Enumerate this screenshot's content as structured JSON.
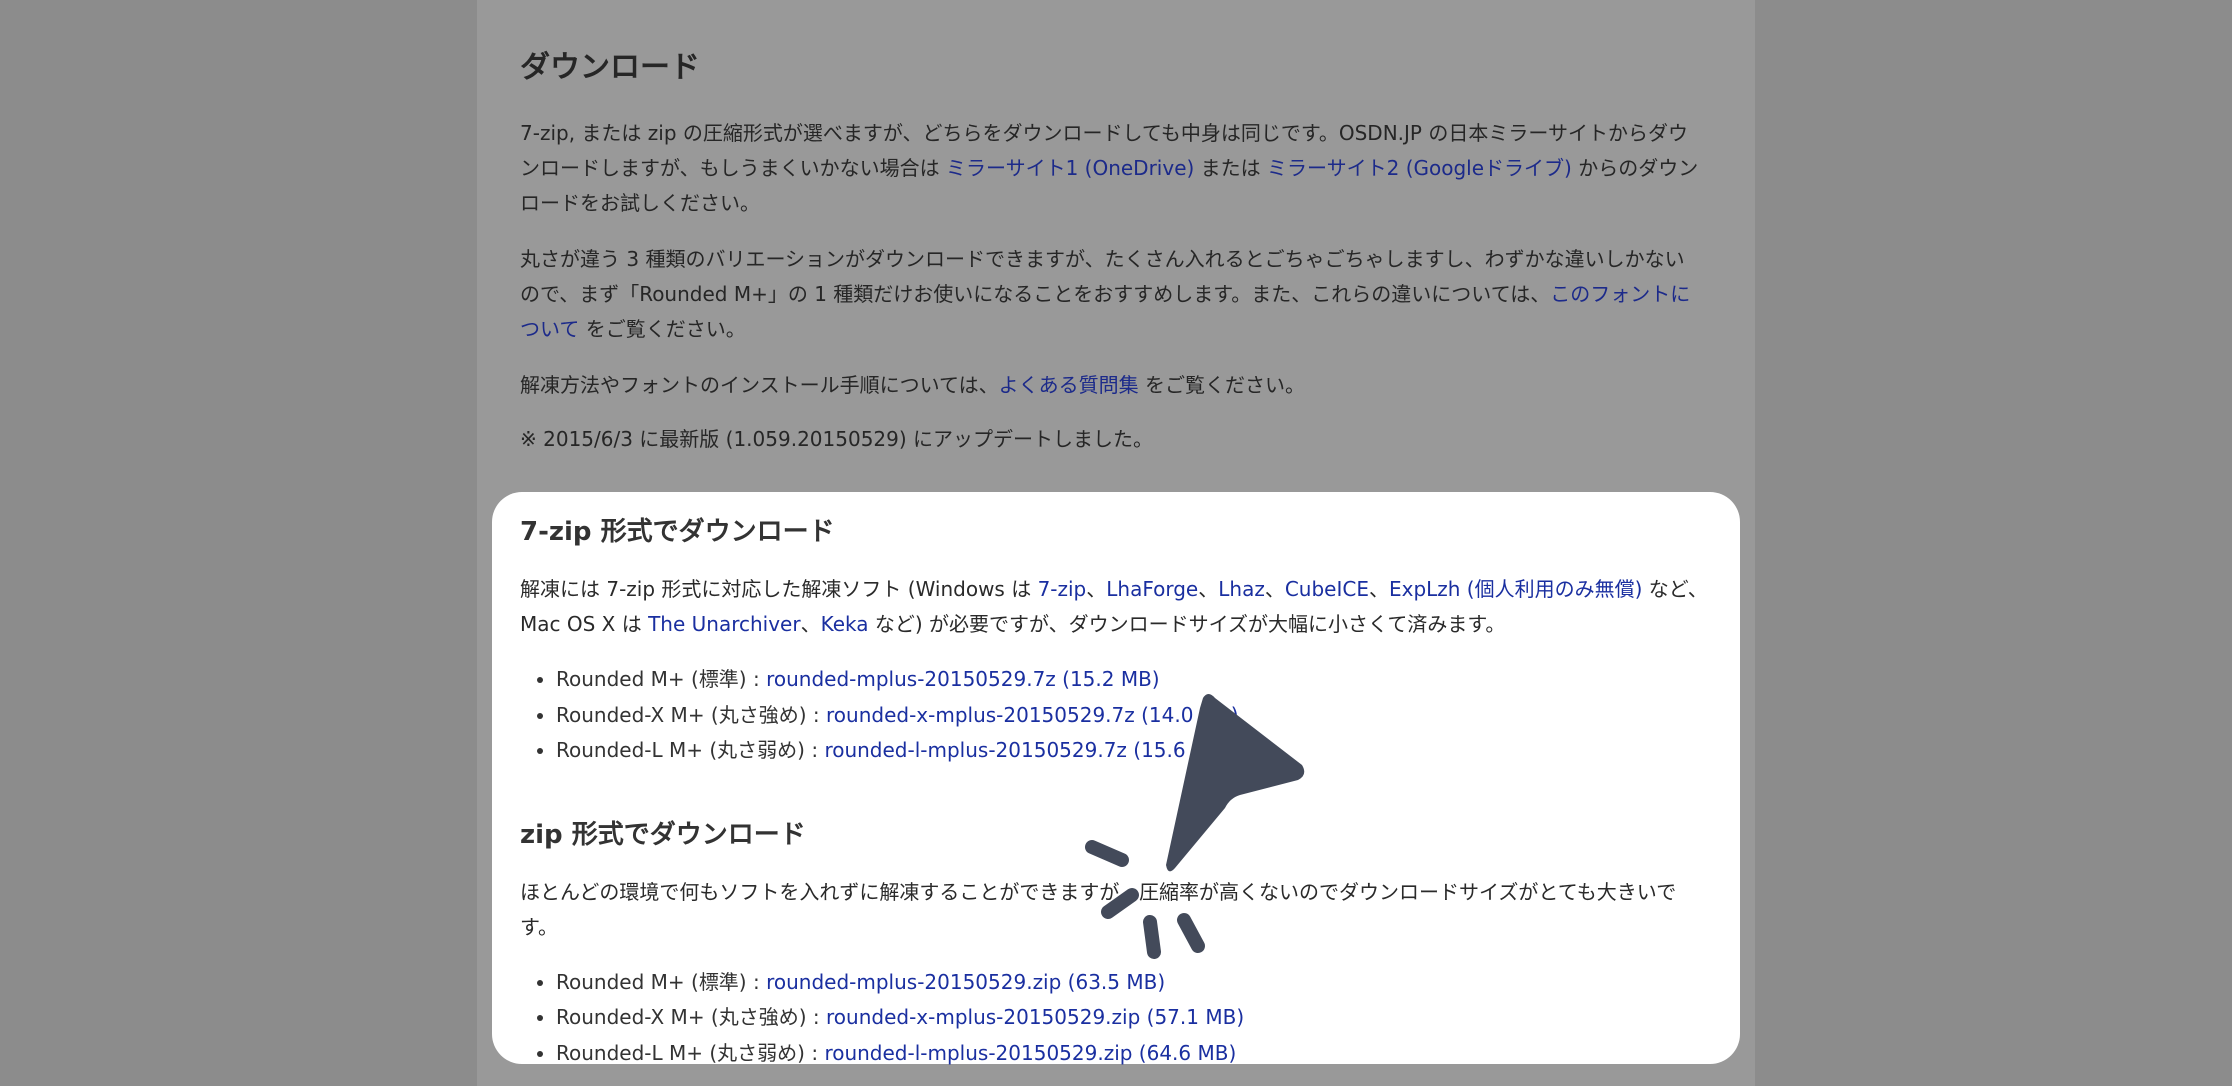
{
  "main": {
    "title": "ダウンロード",
    "p1": {
      "t1": "7-zip, または zip の圧縮形式が選べますが、どちらをダウンロードしても中身は同じです。OSDN.JP の日本ミラーサイトからダウンロードしますが、もしうまくいかない場合は ",
      "link1": "ミラーサイト1 (OneDrive)",
      "t2": " または ",
      "link2": "ミラーサイト2 (Googleドライブ)",
      "t3": " からのダウンロードをお試しください。"
    },
    "p2": {
      "t1": "丸さが違う 3 種類のバリエーションがダウンロードできますが、たくさん入れるとごちゃごちゃしますし、わずかな違いしかないので、まず「Rounded M+」の 1 種類だけお使いになることをおすすめします。また、これらの違いについては、",
      "link": "このフォントについて",
      "t2": " をご覧ください。"
    },
    "p3": {
      "t1": "解凍方法やフォントのインストール手順については、",
      "link": "よくある質問集",
      "t2": " をご覧ください。"
    },
    "p4": "※ 2015/6/3 に最新版 (1.059.20150529) にアップデートしました。"
  },
  "sevenzip": {
    "title": "7-zip 形式でダウンロード",
    "desc": {
      "t1": "解凍には 7-zip 形式に対応した解凍ソフト (Windows は ",
      "l1": "7-zip",
      "s1": "、",
      "l2": "LhaForge",
      "s2": "、",
      "l3": "Lhaz",
      "s3": "、",
      "l4": "CubeICE",
      "s4": "、",
      "l5": "ExpLzh (個人利用のみ無償)",
      "t2": " など、Mac OS X は ",
      "l6": "The Unarchiver",
      "s5": "、",
      "l7": "Keka",
      "t3": " など) が必要ですが、ダウンロードサイズが大幅に小さくて済みます。"
    },
    "items": [
      {
        "label": "Rounded M+ (標準) : ",
        "link": "rounded-mplus-20150529.7z (15.2 MB)"
      },
      {
        "label": "Rounded-X M+ (丸さ強め) : ",
        "link": "rounded-x-mplus-20150529.7z (14.0 MB)"
      },
      {
        "label": "Rounded-L M+ (丸さ弱め) : ",
        "link": "rounded-l-mplus-20150529.7z (15.6 MB)"
      }
    ]
  },
  "zip": {
    "title": "zip 形式でダウンロード",
    "desc": "ほとんどの環境で何もソフトを入れずに解凍することができますが、圧縮率が高くないのでダウンロードサイズがとても大きいです。",
    "items": [
      {
        "label": "Rounded M+ (標準) : ",
        "link": "rounded-mplus-20150529.zip (63.5 MB)"
      },
      {
        "label": "Rounded-X M+ (丸さ強め) : ",
        "link": "rounded-x-mplus-20150529.zip (57.1 MB)"
      },
      {
        "label": "Rounded-L M+ (丸さ弱め) : ",
        "link": "rounded-l-mplus-20150529.zip (64.6 MB)"
      }
    ]
  },
  "colors": {
    "link": "#1a2fa0",
    "cursor": "#434a5a",
    "overlay": "#8c8c8c"
  },
  "cursor_icon": "click-pointer-icon"
}
